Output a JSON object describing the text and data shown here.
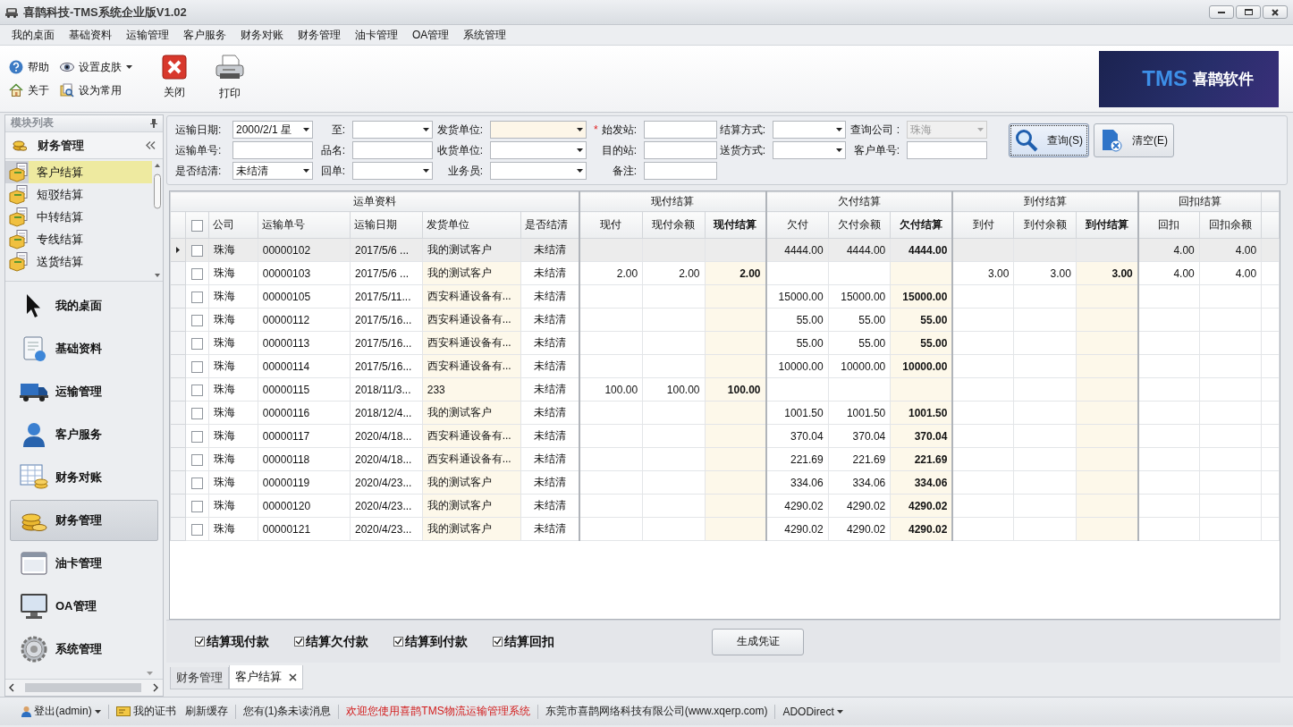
{
  "window": {
    "title": "喜鹊科技-TMS系统企业版V1.02"
  },
  "menu": [
    "我的桌面",
    "基础资料",
    "运输管理",
    "客户服务",
    "财务对账",
    "财务管理",
    "油卡管理",
    "OA管理",
    "系统管理"
  ],
  "ribbon": {
    "small_buttons": [
      {
        "label": "帮助",
        "dropdown": false
      },
      {
        "label": "设置皮肤",
        "dropdown": true
      },
      {
        "label": "关于",
        "dropdown": false
      },
      {
        "label": "设为常用",
        "dropdown": false
      }
    ],
    "large_buttons": [
      {
        "label": "关闭"
      },
      {
        "label": "打印"
      }
    ],
    "logo": {
      "mark": "TMS",
      "name": "喜鹊软件"
    }
  },
  "sidebar": {
    "title": "模块列表",
    "group": "财务管理",
    "items": [
      {
        "label": "客户结算",
        "selected": true
      },
      {
        "label": "短驳结算",
        "selected": false
      },
      {
        "label": "中转结算",
        "selected": false
      },
      {
        "label": "专线结算",
        "selected": false
      },
      {
        "label": "送货结算",
        "selected": false
      }
    ],
    "modules": [
      {
        "label": "我的桌面",
        "selected": false
      },
      {
        "label": "基础资料",
        "selected": false
      },
      {
        "label": "运输管理",
        "selected": false
      },
      {
        "label": "客户服务",
        "selected": false
      },
      {
        "label": "财务对账",
        "selected": false
      },
      {
        "label": "财务管理",
        "selected": true
      },
      {
        "label": "油卡管理",
        "selected": false
      },
      {
        "label": "OA管理",
        "selected": false
      },
      {
        "label": "系统管理",
        "selected": false
      }
    ]
  },
  "filters": [
    [
      {
        "label": "运输日期:",
        "kind": "select",
        "value": "2000/2/1 星"
      },
      {
        "label": "至:",
        "kind": "select"
      },
      {
        "label": "发货单位:",
        "kind": "select",
        "focused": true
      },
      {
        "label": "始发站:",
        "kind": "text",
        "marker": "*"
      },
      {
        "label": "结算方式:",
        "kind": "select"
      },
      {
        "label": "查询公司 :",
        "kind": "select",
        "value": "珠海",
        "disabled": true
      }
    ],
    [
      {
        "label": "运输单号:",
        "kind": "text"
      },
      {
        "label": "品名:",
        "kind": "text"
      },
      {
        "label": "收货单位:",
        "kind": "select"
      },
      {
        "label": "目的站:",
        "kind": "text"
      },
      {
        "label": "送货方式:",
        "kind": "select"
      },
      {
        "label": "客户单号:",
        "kind": "text"
      }
    ],
    [
      {
        "label": "是否结清:",
        "kind": "select",
        "value": "未结清"
      },
      {
        "label": "回单:",
        "kind": "select"
      },
      {
        "label": "业务员:",
        "kind": "select"
      },
      {
        "label": "备注:",
        "kind": "text"
      }
    ]
  ],
  "actions": [
    {
      "label": "查询(S)",
      "focused": true
    },
    {
      "label": "清空(E)",
      "focused": false
    }
  ],
  "grid": {
    "header_checked": false,
    "groups": [
      {
        "label": "运单资料",
        "columns": [
          {
            "label": "公司",
            "bold": false,
            "shaded": false
          },
          {
            "label": "运输单号",
            "bold": false,
            "shaded": false
          },
          {
            "label": "运输日期",
            "bold": false,
            "shaded": false
          },
          {
            "label": "发货单位",
            "bold": false,
            "shaded": true
          },
          {
            "label": "是否结清",
            "bold": false,
            "shaded": false
          }
        ]
      },
      {
        "label": "现付结算",
        "columns": [
          {
            "label": "现付",
            "bold": false,
            "shaded": false
          },
          {
            "label": "现付余额",
            "bold": false,
            "shaded": false
          },
          {
            "label": "现付结算",
            "bold": true,
            "shaded": true
          }
        ]
      },
      {
        "label": "欠付结算",
        "columns": [
          {
            "label": "欠付",
            "bold": false,
            "shaded": false
          },
          {
            "label": "欠付余额",
            "bold": false,
            "shaded": false
          },
          {
            "label": "欠付结算",
            "bold": true,
            "shaded": true
          }
        ]
      },
      {
        "label": "到付结算",
        "columns": [
          {
            "label": "到付",
            "bold": false,
            "shaded": false
          },
          {
            "label": "到付余额",
            "bold": false,
            "shaded": false
          },
          {
            "label": "到付结算",
            "bold": true,
            "shaded": true
          }
        ]
      },
      {
        "label": "回扣结算",
        "columns": [
          {
            "label": "回扣",
            "bold": false,
            "shaded": false
          },
          {
            "label": "回扣余额",
            "bold": false,
            "shaded": false
          }
        ]
      }
    ],
    "rows": [
      {
        "selected": true,
        "checked": false,
        "cells": [
          "珠海",
          "00000102",
          "2017/5/6 ...",
          "我的测试客户",
          "未结清",
          null,
          null,
          null,
          "4444.00",
          "4444.00",
          "4444.00",
          null,
          null,
          null,
          "4.00",
          "4.00"
        ]
      },
      {
        "selected": false,
        "checked": false,
        "cells": [
          "珠海",
          "00000103",
          "2017/5/6 ...",
          "我的测试客户",
          "未结清",
          "2.00",
          "2.00",
          "2.00",
          null,
          null,
          null,
          "3.00",
          "3.00",
          "3.00",
          "4.00",
          "4.00"
        ]
      },
      {
        "selected": false,
        "checked": false,
        "cells": [
          "珠海",
          "00000105",
          "2017/5/11...",
          "西安科通设备有...",
          "未结清",
          null,
          null,
          null,
          "15000.00",
          "15000.00",
          "15000.00",
          null,
          null,
          null,
          null,
          null
        ]
      },
      {
        "selected": false,
        "checked": false,
        "cells": [
          "珠海",
          "00000112",
          "2017/5/16...",
          "西安科通设备有...",
          "未结清",
          null,
          null,
          null,
          "55.00",
          "55.00",
          "55.00",
          null,
          null,
          null,
          null,
          null
        ]
      },
      {
        "selected": false,
        "checked": false,
        "cells": [
          "珠海",
          "00000113",
          "2017/5/16...",
          "西安科通设备有...",
          "未结清",
          null,
          null,
          null,
          "55.00",
          "55.00",
          "55.00",
          null,
          null,
          null,
          null,
          null
        ]
      },
      {
        "selected": false,
        "checked": false,
        "cells": [
          "珠海",
          "00000114",
          "2017/5/16...",
          "西安科通设备有...",
          "未结清",
          null,
          null,
          null,
          "10000.00",
          "10000.00",
          "10000.00",
          null,
          null,
          null,
          null,
          null
        ]
      },
      {
        "selected": false,
        "checked": false,
        "cells": [
          "珠海",
          "00000115",
          "2018/11/3...",
          "233",
          "未结清",
          "100.00",
          "100.00",
          "100.00",
          null,
          null,
          null,
          null,
          null,
          null,
          null,
          null
        ]
      },
      {
        "selected": false,
        "checked": false,
        "cells": [
          "珠海",
          "00000116",
          "2018/12/4...",
          "我的测试客户",
          "未结清",
          null,
          null,
          null,
          "1001.50",
          "1001.50",
          "1001.50",
          null,
          null,
          null,
          null,
          null
        ]
      },
      {
        "selected": false,
        "checked": false,
        "cells": [
          "珠海",
          "00000117",
          "2020/4/18...",
          "西安科通设备有...",
          "未结清",
          null,
          null,
          null,
          "370.04",
          "370.04",
          "370.04",
          null,
          null,
          null,
          null,
          null
        ]
      },
      {
        "selected": false,
        "checked": false,
        "cells": [
          "珠海",
          "00000118",
          "2020/4/18...",
          "西安科通设备有...",
          "未结清",
          null,
          null,
          null,
          "221.69",
          "221.69",
          "221.69",
          null,
          null,
          null,
          null,
          null
        ]
      },
      {
        "selected": false,
        "checked": false,
        "cells": [
          "珠海",
          "00000119",
          "2020/4/23...",
          "我的测试客户",
          "未结清",
          null,
          null,
          null,
          "334.06",
          "334.06",
          "334.06",
          null,
          null,
          null,
          null,
          null
        ]
      },
      {
        "selected": false,
        "checked": false,
        "cells": [
          "珠海",
          "00000120",
          "2020/4/23...",
          "我的测试客户",
          "未结清",
          null,
          null,
          null,
          "4290.02",
          "4290.02",
          "4290.02",
          null,
          null,
          null,
          null,
          null
        ]
      },
      {
        "selected": false,
        "checked": false,
        "cells": [
          "珠海",
          "00000121",
          "2020/4/23...",
          "我的测试客户",
          "未结清",
          null,
          null,
          null,
          "4290.02",
          "4290.02",
          "4290.02",
          null,
          null,
          null,
          null,
          null
        ]
      }
    ]
  },
  "options": [
    {
      "label": "结算现付款",
      "checked": true
    },
    {
      "label": "结算欠付款",
      "checked": true
    },
    {
      "label": "结算到付款",
      "checked": true
    },
    {
      "label": "结算回扣",
      "checked": true
    }
  ],
  "generate_button": "生成凭证",
  "tabs": [
    {
      "label": "财务管理",
      "selected": false,
      "closable": false
    },
    {
      "label": "客户结算",
      "selected": true,
      "closable": true
    }
  ],
  "status": [
    [
      {
        "text": "登出(admin)",
        "kind": "user",
        "dropdown": true
      }
    ],
    [
      {
        "text": "我的证书",
        "kind": "certificate",
        "dropdown": false
      },
      {
        "text": "刷新缓存",
        "kind": "link",
        "dropdown": false
      }
    ],
    [
      {
        "text": "您有(1)条未读消息",
        "kind": "link",
        "dropdown": false
      }
    ],
    [
      {
        "text": "欢迎您使用喜鹊TMS物流运输管理系统",
        "kind": "notice",
        "dropdown": false
      }
    ],
    [
      {
        "text": "东莞市喜鹊网络科技有限公司(www.xqerp.com)",
        "kind": "text",
        "dropdown": false
      }
    ],
    [
      {
        "text": "ADODirect",
        "kind": "link",
        "dropdown": true
      }
    ]
  ]
}
